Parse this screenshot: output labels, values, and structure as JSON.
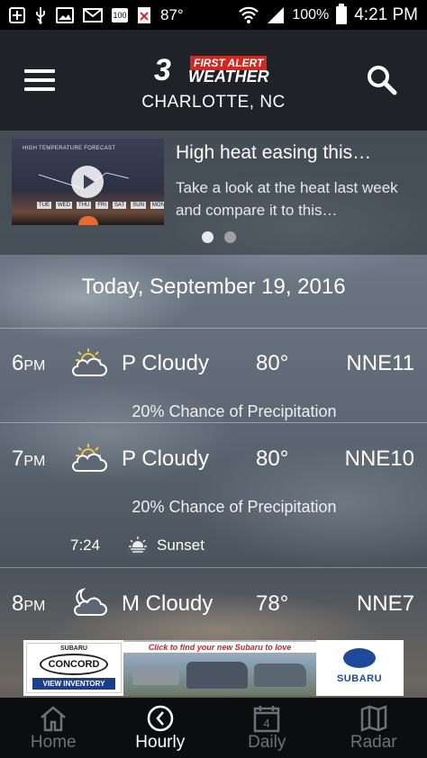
{
  "status_bar": {
    "temperature": "87°",
    "battery_percent": "100%",
    "time": "4:21 PM",
    "notification_badge": "100"
  },
  "header": {
    "logo_number": "3",
    "logo_line1": "FIRST ALERT",
    "logo_line2": "WEATHER",
    "location": "CHARLOTTE, NC"
  },
  "featured": {
    "title": "High heat easing this…",
    "text": "Take a look at the heat last week and compare it to this…",
    "thumbnail_caption": "HIGH TEMPERATURE FORECAST",
    "thumbnail_days": [
      "TUE",
      "WED",
      "THU",
      "FRI",
      "SAT",
      "SUN",
      "MON"
    ],
    "page_count": 2,
    "active_page": 1
  },
  "date_heading": "Today, September 19, 2016",
  "hours": [
    {
      "hour": "6",
      "ampm": "PM",
      "icon": "partly-cloudy-sun-icon",
      "condition": "P Cloudy",
      "temp": "80°",
      "wind": "NNE11",
      "precip": "20% Chance of Precipitation"
    },
    {
      "hour": "7",
      "ampm": "PM",
      "icon": "partly-cloudy-sun-icon",
      "condition": "P Cloudy",
      "temp": "80°",
      "wind": "NNE10",
      "precip": "20% Chance of Precipitation",
      "sunset_time": "7:24",
      "sunset_label": "Sunset"
    },
    {
      "hour": "8",
      "ampm": "PM",
      "icon": "cloudy-moon-icon",
      "condition": "M Cloudy",
      "temp": "78°",
      "wind": "NNE7"
    }
  ],
  "ad": {
    "dealer_top": "SUBARU",
    "dealer_name": "CONCORD",
    "dealer_button": "VIEW INVENTORY",
    "headline": "Click to find your new Subaru to love",
    "brand": "SUBARU"
  },
  "nav": {
    "tabs": [
      {
        "label": "Home",
        "icon": "home-icon"
      },
      {
        "label": "Hourly",
        "icon": "clock-icon"
      },
      {
        "label": "Daily",
        "icon": "calendar-icon",
        "badge": "4"
      },
      {
        "label": "Radar",
        "icon": "map-icon"
      }
    ],
    "active": "Hourly"
  }
}
